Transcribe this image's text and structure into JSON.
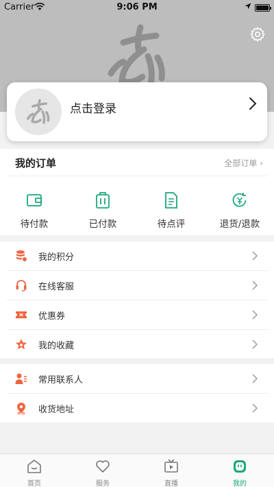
{
  "status_bar": {
    "carrier": "Carrier",
    "time": "9:06 PM"
  },
  "header": {
    "settings_icon": "gear-icon",
    "logo_icon": "brand-logo"
  },
  "login": {
    "label": "点击登录"
  },
  "orders": {
    "title": "我的订单",
    "all_link": "全部订单 ›",
    "items": [
      {
        "label": "待付款",
        "icon": "wallet-icon"
      },
      {
        "label": "已付款",
        "icon": "luggage-icon"
      },
      {
        "label": "待点评",
        "icon": "document-icon"
      },
      {
        "label": "退货/退款",
        "icon": "refund-icon"
      }
    ]
  },
  "menu1": [
    {
      "label": "我的积分",
      "icon": "points-icon"
    },
    {
      "label": "在线客服",
      "icon": "headset-icon"
    },
    {
      "label": "优惠券",
      "icon": "coupon-icon"
    },
    {
      "label": "我的收藏",
      "icon": "star-icon"
    }
  ],
  "menu2": [
    {
      "label": "常用联系人",
      "icon": "contacts-icon"
    },
    {
      "label": "收货地址",
      "icon": "location-pin-icon"
    }
  ],
  "tabbar": [
    {
      "label": "首页",
      "icon": "home-icon"
    },
    {
      "label": "服务",
      "icon": "heart-icon"
    },
    {
      "label": "直播",
      "icon": "tv-icon"
    },
    {
      "label": "我的",
      "icon": "profile-icon"
    }
  ],
  "colors": {
    "accent": "#1aa87a",
    "menu_icon": "#f0653f",
    "header_bg": "#bdbdbd"
  }
}
